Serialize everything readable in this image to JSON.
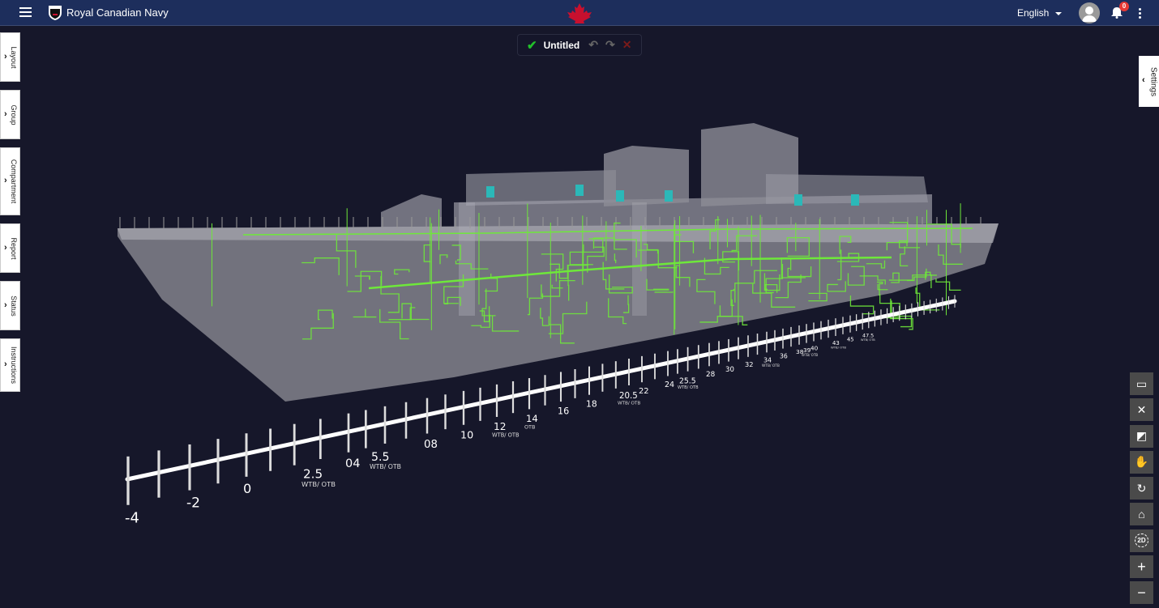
{
  "header": {
    "app_title": "Royal Canadian Navy",
    "language": "English",
    "notification_count": "0",
    "brand_color": "#1d2e5c",
    "leaf_color": "#c8102e"
  },
  "document": {
    "name": "Untitled",
    "saved_icon": "check-icon",
    "undo_icon": "undo-icon",
    "redo_icon": "redo-icon",
    "close_icon": "close-icon"
  },
  "left_tabs": [
    {
      "label": "Layout"
    },
    {
      "label": "Group"
    },
    {
      "label": "Compartment"
    },
    {
      "label": "Report"
    },
    {
      "label": "Status"
    },
    {
      "label": "Instructions"
    }
  ],
  "right_tab": {
    "label": "Settings"
  },
  "toolbar": [
    {
      "name": "fit-view",
      "icon": "screen-icon"
    },
    {
      "name": "measure",
      "icon": "tools-icon"
    },
    {
      "name": "section",
      "icon": "section-icon"
    },
    {
      "name": "pan",
      "icon": "hand-icon"
    },
    {
      "name": "rotate",
      "icon": "refresh-icon"
    },
    {
      "name": "home",
      "icon": "home-icon"
    },
    {
      "name": "toggle-2d",
      "icon": "2d-icon",
      "label": "2D"
    },
    {
      "name": "zoom-in",
      "icon": "plus-icon"
    },
    {
      "name": "zoom-out",
      "icon": "minus-icon"
    }
  ],
  "viewer": {
    "pipe_color": "#6ee83a",
    "frame_labels": [
      {
        "v": -4,
        "t": "-4"
      },
      {
        "v": -2,
        "t": "-2"
      },
      {
        "v": 0,
        "t": "0"
      },
      {
        "v": 2.5,
        "t": "2.5",
        "sub": "WTB/ OTB"
      },
      {
        "v": 4,
        "t": "04"
      },
      {
        "v": 5.5,
        "t": "5.5",
        "sub": "WTB/ OTB"
      },
      {
        "v": 8,
        "t": "08"
      },
      {
        "v": 10,
        "t": "10"
      },
      {
        "v": 12,
        "t": "12",
        "sub": "WTB/ OTB"
      },
      {
        "v": 14,
        "t": "14",
        "sub": "OTB"
      },
      {
        "v": 16,
        "t": "16"
      },
      {
        "v": 18,
        "t": "18"
      },
      {
        "v": 20.5,
        "t": "20.5",
        "sub": "WTB/ OTB"
      },
      {
        "v": 22,
        "t": "22"
      },
      {
        "v": 24,
        "t": "24"
      },
      {
        "v": 25.5,
        "t": "25.5",
        "sub": "WTB/ OTB"
      },
      {
        "v": 28,
        "t": "28"
      },
      {
        "v": 30,
        "t": "30"
      },
      {
        "v": 32,
        "t": "32"
      },
      {
        "v": 34,
        "t": "34",
        "sub": "WTB/ OTB"
      },
      {
        "v": 36,
        "t": "36"
      },
      {
        "v": 38,
        "t": "38"
      },
      {
        "v": 39,
        "t": "39",
        "sub": "WTB/ OTB"
      },
      {
        "v": 40,
        "t": "40"
      },
      {
        "v": 43,
        "t": "43",
        "sub": "WTB/ OTB"
      },
      {
        "v": 45,
        "t": "45"
      },
      {
        "v": 47.5,
        "t": "47.5",
        "sub": "WTB/ OTB"
      }
    ]
  }
}
